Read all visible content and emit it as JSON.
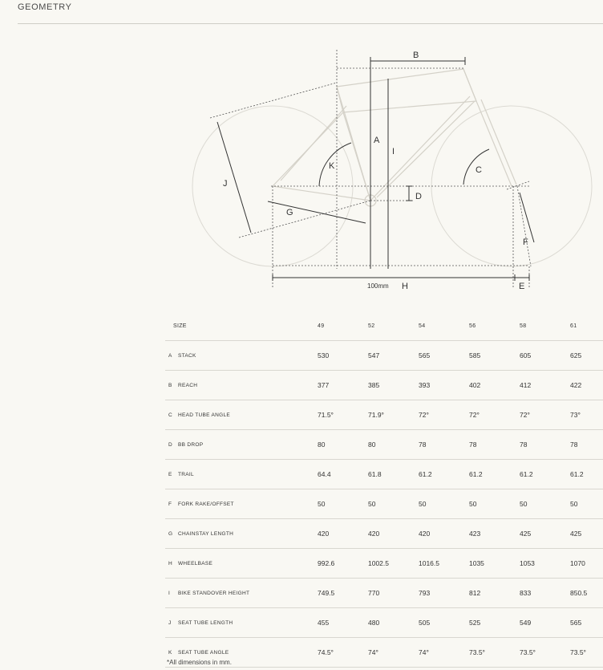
{
  "section": {
    "title": "GEOMETRY"
  },
  "diagram": {
    "labels": {
      "A": "A",
      "B": "B",
      "C": "C",
      "D": "D",
      "E": "E",
      "F": "F",
      "G": "G",
      "H": "H",
      "I": "I",
      "J": "J",
      "K": "K"
    },
    "offset_label": "100mm"
  },
  "table": {
    "size_header": "SIZE",
    "sizes": [
      "49",
      "52",
      "54",
      "56",
      "58",
      "61"
    ],
    "rows": [
      {
        "letter": "A",
        "label": "STACK",
        "values": [
          "530",
          "547",
          "565",
          "585",
          "605",
          "625"
        ]
      },
      {
        "letter": "B",
        "label": "REACH",
        "values": [
          "377",
          "385",
          "393",
          "402",
          "412",
          "422"
        ]
      },
      {
        "letter": "C",
        "label": "HEAD TUBE ANGLE",
        "values": [
          "71.5°",
          "71.9°",
          "72°",
          "72°",
          "72°",
          "73°"
        ]
      },
      {
        "letter": "D",
        "label": "BB DROP",
        "values": [
          "80",
          "80",
          "78",
          "78",
          "78",
          "78"
        ]
      },
      {
        "letter": "E",
        "label": "TRAIL",
        "values": [
          "64.4",
          "61.8",
          "61.2",
          "61.2",
          "61.2",
          "61.2"
        ]
      },
      {
        "letter": "F",
        "label": "FORK RAKE/OFFSET",
        "values": [
          "50",
          "50",
          "50",
          "50",
          "50",
          "50"
        ]
      },
      {
        "letter": "G",
        "label": "CHAINSTAY LENGTH",
        "values": [
          "420",
          "420",
          "420",
          "423",
          "425",
          "425"
        ]
      },
      {
        "letter": "H",
        "label": "WHEELBASE",
        "values": [
          "992.6",
          "1002.5",
          "1016.5",
          "1035",
          "1053",
          "1070"
        ]
      },
      {
        "letter": "I",
        "label": "BIKE STANDOVER HEIGHT",
        "values": [
          "749.5",
          "770",
          "793",
          "812",
          "833",
          "850.5"
        ]
      },
      {
        "letter": "J",
        "label": "SEAT TUBE LENGTH",
        "values": [
          "455",
          "480",
          "505",
          "525",
          "549",
          "565"
        ]
      },
      {
        "letter": "K",
        "label": "SEAT TUBE ANGLE",
        "values": [
          "74.5°",
          "74°",
          "74°",
          "73.5°",
          "73.5°",
          "73.5°"
        ]
      }
    ]
  },
  "footnote": "*All dimensions in mm."
}
